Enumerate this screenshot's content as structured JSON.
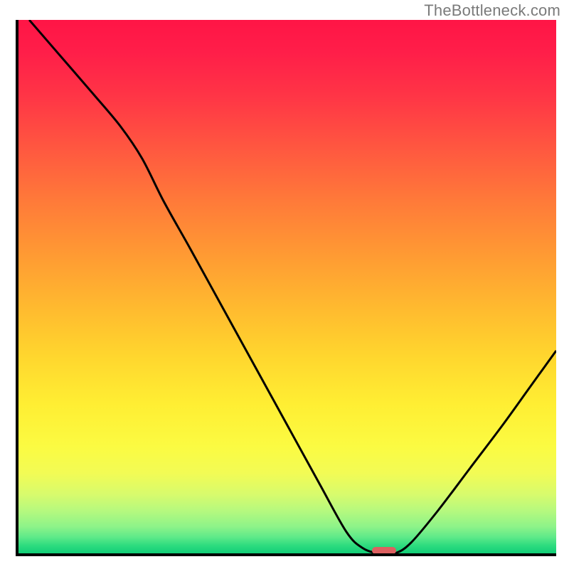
{
  "watermark": "TheBottleneck.com",
  "chart_data": {
    "type": "line",
    "title": "",
    "xlabel": "",
    "ylabel": "",
    "xlim": [
      0,
      100
    ],
    "ylim": [
      0,
      100
    ],
    "grid": false,
    "curve_points": [
      {
        "x": 2,
        "y": 100
      },
      {
        "x": 8,
        "y": 93
      },
      {
        "x": 14,
        "y": 86
      },
      {
        "x": 19,
        "y": 80
      },
      {
        "x": 23,
        "y": 74
      },
      {
        "x": 27,
        "y": 66
      },
      {
        "x": 32,
        "y": 57
      },
      {
        "x": 38,
        "y": 46
      },
      {
        "x": 44,
        "y": 35
      },
      {
        "x": 50,
        "y": 24
      },
      {
        "x": 56,
        "y": 13
      },
      {
        "x": 61,
        "y": 4
      },
      {
        "x": 64,
        "y": 1
      },
      {
        "x": 67,
        "y": 0
      },
      {
        "x": 70,
        "y": 0
      },
      {
        "x": 73,
        "y": 2
      },
      {
        "x": 78,
        "y": 8
      },
      {
        "x": 84,
        "y": 16
      },
      {
        "x": 90,
        "y": 24
      },
      {
        "x": 95,
        "y": 31
      },
      {
        "x": 100,
        "y": 38
      }
    ],
    "marker": {
      "x": 68,
      "y": 0.5,
      "width_pct": 4.5,
      "height_pct": 1.3
    },
    "stroke_color": "#000000",
    "stroke_width": 3
  }
}
